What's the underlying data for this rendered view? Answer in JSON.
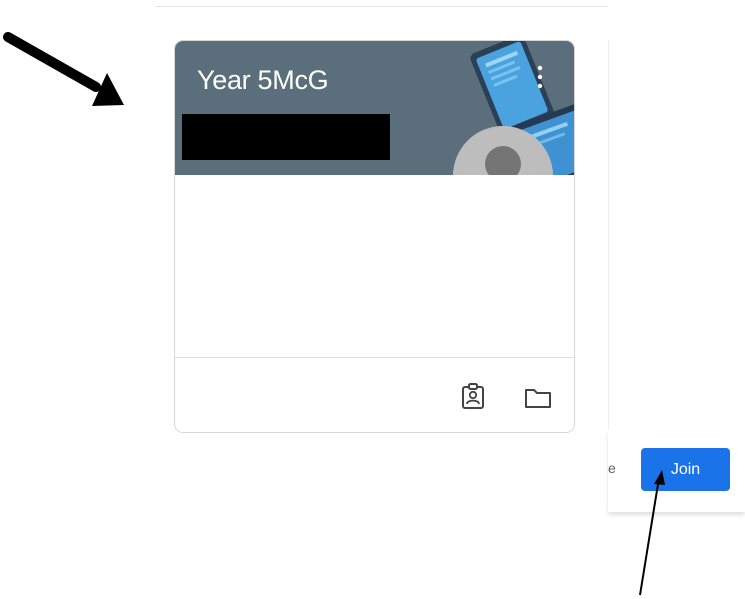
{
  "class_card": {
    "title": "Year 5McG",
    "subtitle_redacted": true,
    "banner_color": "#5b6e7b",
    "icons": {
      "menu": "more-vert-icon",
      "avatar": "default-avatar-icon",
      "assignment": "assignment-ind-icon",
      "folder": "folder-icon"
    }
  },
  "join_panel": {
    "cut_text": "e",
    "join_label": "Join",
    "button_color": "#1a73e8"
  },
  "annotations": {
    "arrow_color": "#000000",
    "arrows": [
      "arrow-to-class-card",
      "arrow-to-join-button"
    ]
  }
}
